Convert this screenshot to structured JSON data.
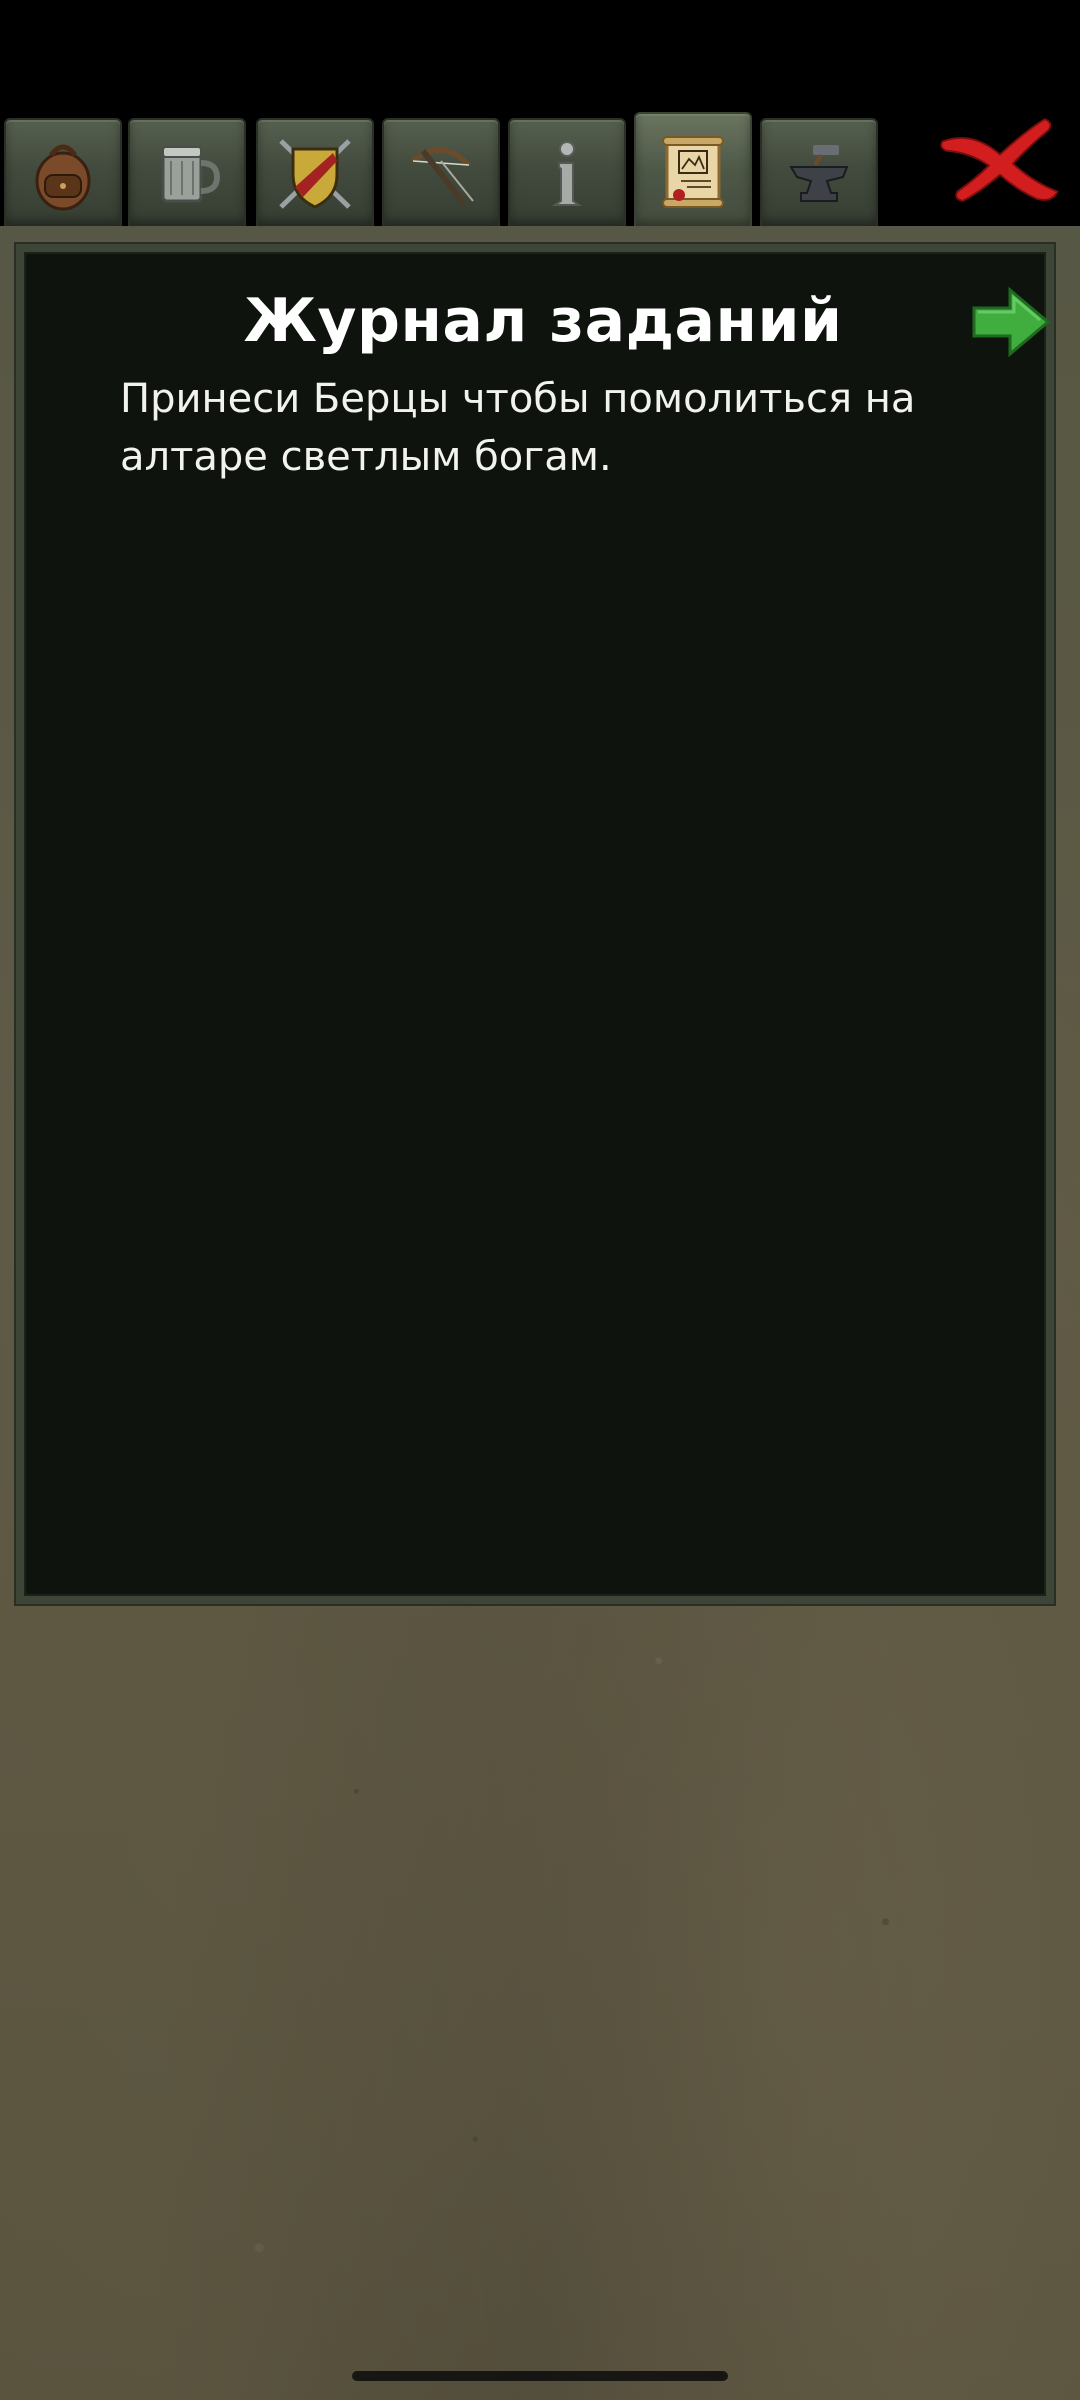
{
  "tabs": [
    {
      "icon": "backpack-icon",
      "active": false
    },
    {
      "icon": "tankard-icon",
      "active": false
    },
    {
      "icon": "shield-swords-icon",
      "active": false
    },
    {
      "icon": "crossbow-icon",
      "active": false
    },
    {
      "icon": "info-icon",
      "active": false
    },
    {
      "icon": "quest-scroll-icon",
      "active": true
    },
    {
      "icon": "anvil-icon",
      "active": false
    }
  ],
  "close_icon": "red-x-close-icon",
  "journal": {
    "title": "Журнал заданий",
    "next_icon": "green-arrow-right-icon",
    "quest_text": "Принеси Берцы чтобы помолиться на алтаре светлым богам."
  },
  "colors": {
    "panel_bg": "#0e130e",
    "frame_stone": "#5f5a46",
    "close_red": "#d21e1e",
    "arrow_green": "#3fae3f"
  }
}
